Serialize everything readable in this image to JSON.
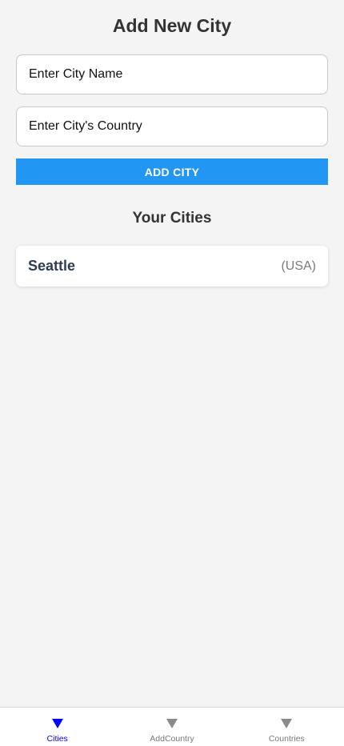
{
  "header": {
    "title": "Add New City"
  },
  "form": {
    "city_name_placeholder": "Enter City Name",
    "city_name_value": "",
    "country_placeholder": "Enter City's Country",
    "country_value": "",
    "add_button_label": "ADD CITY"
  },
  "cities_section": {
    "title": "Your Cities",
    "items": [
      {
        "name": "Seattle",
        "country": "(USA)"
      }
    ]
  },
  "tab_bar": {
    "tabs": [
      {
        "label": "Cities",
        "icon": "triangle-down-icon",
        "active": true
      },
      {
        "label": "AddCountry",
        "icon": "triangle-down-icon",
        "active": false
      },
      {
        "label": "Countries",
        "icon": "triangle-down-icon",
        "active": false
      }
    ]
  },
  "colors": {
    "accent": "#2196f3",
    "active_tab": "#0000ff",
    "background": "#f4f4f4"
  }
}
